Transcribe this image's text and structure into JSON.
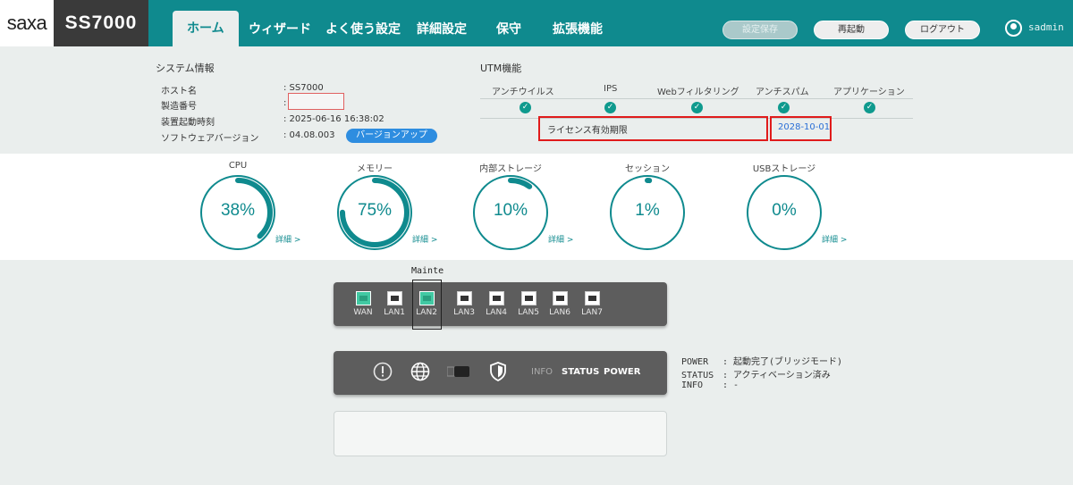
{
  "brand": {
    "logo": "saxa",
    "model": "SS7000"
  },
  "nav": {
    "tabs": [
      {
        "label": "ホーム"
      },
      {
        "label": "ウィザード"
      },
      {
        "label": "よく使う設定"
      },
      {
        "label": "詳細設定"
      },
      {
        "label": "保守"
      },
      {
        "label": "拡張機能"
      }
    ],
    "active": "ホーム",
    "save_settings": "設定保存",
    "reboot": "再起動",
    "logout": "ログアウト",
    "user": "sadmin"
  },
  "system_info": {
    "title": "システム情報",
    "rows": [
      {
        "label": "ホスト名",
        "value": ": SS7000"
      },
      {
        "label": "製造番号",
        "value": ":"
      },
      {
        "label": "装置起動時刻",
        "value": ": 2025-06-16 16:38:02"
      },
      {
        "label": "ソフトウェアバージョン",
        "value": ": 04.08.003"
      }
    ],
    "version_up_button": "バージョンアップ"
  },
  "utm": {
    "title": "UTM機能",
    "features": [
      "アンチウイルス",
      "IPS",
      "Webフィルタリング",
      "アンチスパム",
      "アプリケーション"
    ],
    "license_label": "ライセンス有効期限",
    "license_date": "2028-10-01",
    "status_icon": "check-icon",
    "status_color": "#0f9a8e"
  },
  "gauges": [
    {
      "title": "CPU",
      "value": 38,
      "display": "38%",
      "detail": "詳細 >"
    },
    {
      "title": "メモリー",
      "value": 75,
      "display": "75%",
      "detail": "詳細 >"
    },
    {
      "title": "内部ストレージ",
      "value": 10,
      "display": "10%",
      "detail": "詳細 >"
    },
    {
      "title": "セッション",
      "value": 1,
      "display": "1%",
      "detail": "詳細 >"
    },
    {
      "title": "USBストレージ",
      "value": 0,
      "display": "0%",
      "detail": "詳細 >"
    }
  ],
  "ports": {
    "mainte_label": "Mainte",
    "items": [
      {
        "label": "WAN",
        "active": true
      },
      {
        "label": "LAN1",
        "active": false
      },
      {
        "label": "LAN2",
        "active": true
      },
      {
        "label": "LAN3",
        "active": false
      },
      {
        "label": "LAN4",
        "active": false
      },
      {
        "label": "LAN5",
        "active": false
      },
      {
        "label": "LAN6",
        "active": false
      },
      {
        "label": "LAN7",
        "active": false
      }
    ]
  },
  "status_panel": {
    "icons": [
      "alert-icon",
      "globe-icon",
      "usb-icon",
      "shield-icon"
    ],
    "info_label": "INFO",
    "status_label": "STATUS",
    "power_label": "POWER",
    "details": [
      {
        "key": "POWER",
        "value": ": 起動完了(ブリッジモード)"
      },
      {
        "key": "STATUS",
        "value": ": アクティベーション済み"
      },
      {
        "key": "INFO",
        "value": ": -"
      }
    ]
  },
  "colors": {
    "header": "#0f8a8e",
    "accent": "#0f8a8e",
    "highlight_red": "#e01b1b",
    "port_on": "#42c9a3"
  }
}
